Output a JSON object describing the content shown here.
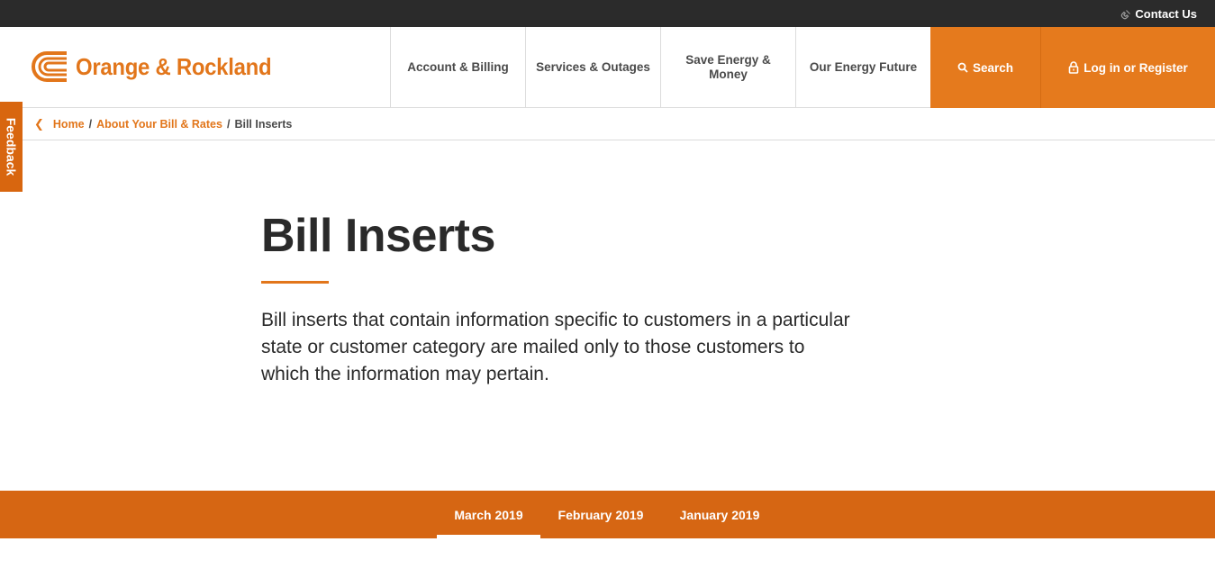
{
  "topbar": {
    "contact_label": "Contact Us",
    "contact_icon": "phone-icon"
  },
  "header": {
    "logo_text": "Orange & Rockland",
    "logo_icon": "orange-rockland-logo-mark",
    "nav": [
      {
        "label": "Account & Billing"
      },
      {
        "label": "Services & Outages"
      },
      {
        "label": "Save Energy & Money"
      },
      {
        "label": "Our Energy Future"
      }
    ],
    "search_label": "Search",
    "search_icon": "search-icon",
    "login_label": "Log in or Register",
    "login_icon": "lock-icon"
  },
  "breadcrumb": {
    "items": [
      "Home",
      "About Your Bill & Rates",
      "Bill Inserts"
    ],
    "separator": "/"
  },
  "feedback_label": "Feedback",
  "main": {
    "title": "Bill Inserts",
    "intro": "Bill inserts that contain information specific to customers in a particular state or customer category are mailed only to those customers to which the information may pertain."
  },
  "tabs": [
    {
      "label": "March 2019",
      "active": true
    },
    {
      "label": "February 2019",
      "active": false
    },
    {
      "label": "January 2019",
      "active": false
    }
  ],
  "colors": {
    "accent": "#e57a1d",
    "tabs_band": "#d66613",
    "topbar": "#2b2b2b",
    "text": "#2a2a2a"
  }
}
